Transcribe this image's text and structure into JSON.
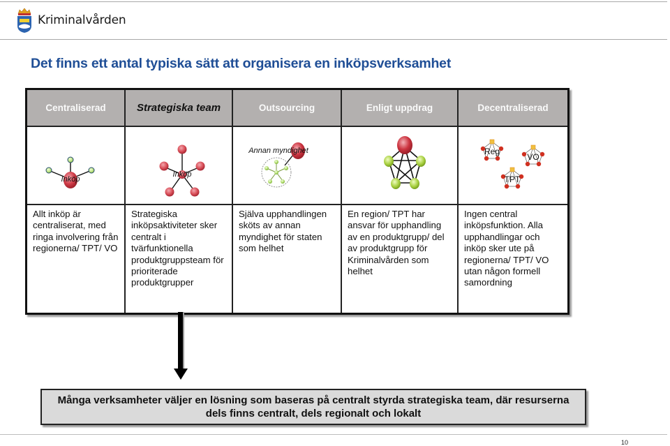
{
  "header": {
    "brand": "Kriminalvården",
    "logo_icon": "coat-of-arms-icon"
  },
  "title": "Det finns ett antal typiska sätt att organisera en inköpsverksamhet",
  "table": {
    "columns": [
      {
        "label": "Centraliserad",
        "active": false,
        "diagram": {
          "type": "hub-spokes",
          "center_label": "Inköp",
          "center_color": "#c8323c",
          "node_color": "#b8e07a",
          "nodes": 3
        },
        "description": "Allt inköp är centraliserat, med ringa involvering från regionerna/ TPT/ VO"
      },
      {
        "label": "Strategiska team",
        "active": true,
        "diagram": {
          "type": "hub-spokes",
          "center_label": "Inköp",
          "center_color": "#c8323c",
          "node_color": "#d9505a",
          "nodes": 5
        },
        "description": "Strategiska inköpsaktiviteter sker centralt i tvärfunktionella produktgruppsteam för prioriterade produktgrupper"
      },
      {
        "label": "Outsourcing",
        "active": false,
        "diagram": {
          "type": "external-agency",
          "agency_label": "Annan myndighet",
          "agency_color": "#c8323c",
          "cluster_color": "#a8d860"
        },
        "description": "Själva upphandlingen sköts av annan myndighet för staten som helhet"
      },
      {
        "label": "Enligt uppdrag",
        "active": false,
        "diagram": {
          "type": "full-mesh",
          "lead_color": "#c8323c",
          "node_color": "#a8d040",
          "nodes": 5
        },
        "description": "En region/ TPT har ansvar för upphandling av en produktgrupp/ del av produktgrupp för Kriminalvården som helhet"
      },
      {
        "label": "Decentraliserad",
        "active": false,
        "diagram": {
          "type": "independent-units",
          "units": [
            "Reg",
            "VO",
            "TPT"
          ],
          "lead_color": "#f0c040",
          "node_color": "#d03020"
        },
        "description": "Ingen central inköpsfunktion. Alla upphandlingar och inköp sker ute på regionerna/ TPT/ VO utan någon formell samordning"
      }
    ]
  },
  "summary": "Många verksamheter väljer en lösning som baseras på centralt styrda strategiska team, där resurserna dels finns centralt, dels regionalt och lokalt",
  "page_number": "10"
}
